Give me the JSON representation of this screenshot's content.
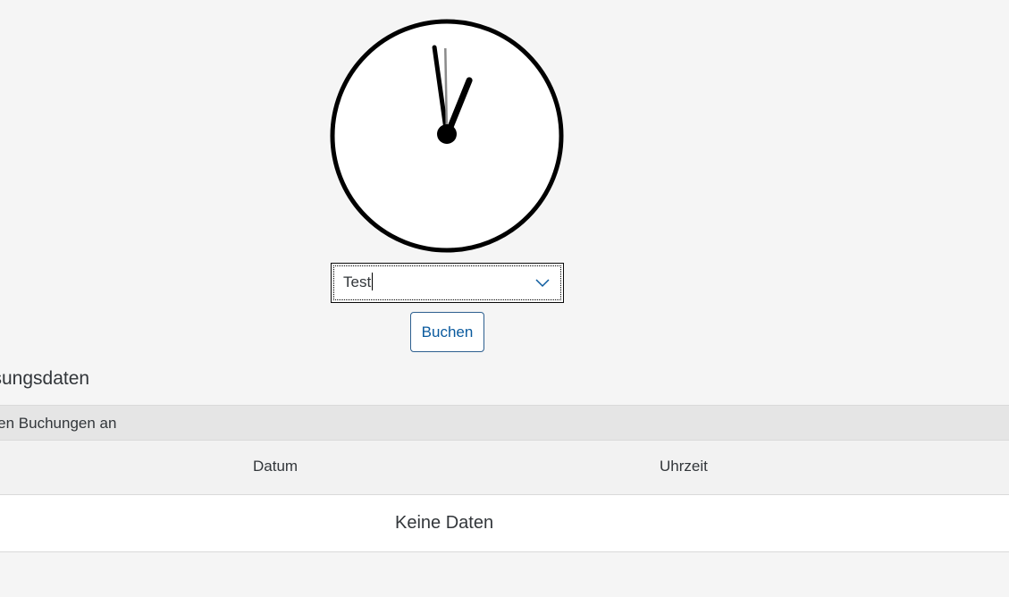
{
  "clock": {
    "hour_hand_angle_deg": 22,
    "minute_hand_angle_deg": -8,
    "second_hand_angle_deg": -1
  },
  "combo": {
    "value": "Test"
  },
  "buchen_button": {
    "label": "Buchen"
  },
  "section": {
    "title": "ssungsdaten"
  },
  "table": {
    "toolbar_text": "gten Buchungen an",
    "columns": [
      "Datum",
      "Uhrzeit"
    ],
    "no_data_text": "Keine Daten"
  },
  "colors": {
    "page_background": "#f5f5f5",
    "button_text": "#0a5a9e",
    "button_border": "#2d5f8f",
    "toolbar_background": "#e5e5e5",
    "header_background": "#f2f2f2"
  }
}
